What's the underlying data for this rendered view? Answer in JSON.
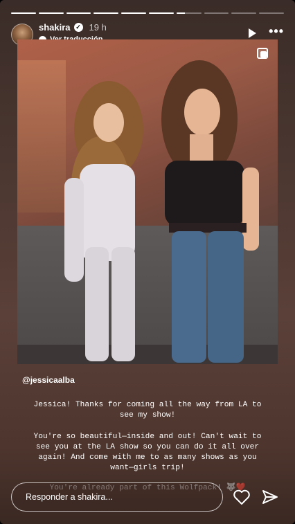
{
  "progress": {
    "segments": [
      1,
      1,
      1,
      1,
      1,
      1,
      0.35,
      0,
      0,
      0
    ],
    "current": 7
  },
  "header": {
    "username": "shakira",
    "time_ago": "19 h",
    "translate_label": "Ver traducción"
  },
  "icons": {
    "verified": "verified-badge-icon",
    "translate": "chat-bubble-icon",
    "play": "play-icon",
    "more": "more-options-icon",
    "carousel": "copy-multiple-icon",
    "like": "heart-icon",
    "send": "send-paper-plane-icon"
  },
  "caption": {
    "mention": "@jessicaalba",
    "paragraph1": "Jessica! Thanks for coming all the way from LA to see my show!",
    "paragraph2": "You're so beautiful—inside and out! Can't wait to see you at the LA show so you can do it all over again! And come with me to as many shows as you want—girls trip!",
    "paragraph3": "You're already part of this Wolfpack! 🐺❤️"
  },
  "reply": {
    "placeholder": "Responder a shakira..."
  },
  "colors": {
    "accent": "#ffffff",
    "background": "#4a3630"
  }
}
